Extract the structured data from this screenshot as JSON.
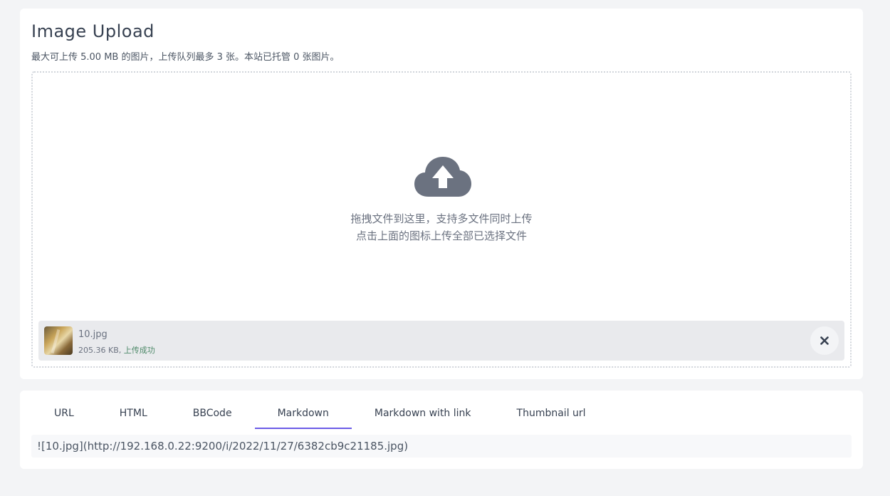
{
  "upload": {
    "title": "Image Upload",
    "subtitle": "最大可上传 5.00 MB 的图片，上传队列最多 3 张。本站已托管 0 张图片。",
    "drop_line1": "拖拽文件到这里，支持多文件同时上传",
    "drop_line2": "点击上面的图标上传全部已选择文件",
    "upload_icon": "cloud-upload-icon",
    "file": {
      "name": "10.jpg",
      "size": "205.36 KB, ",
      "status": "上传成功",
      "remove_icon": "close-icon"
    }
  },
  "result": {
    "tabs": [
      {
        "label": "URL"
      },
      {
        "label": "HTML"
      },
      {
        "label": "BBCode"
      },
      {
        "label": "Markdown"
      },
      {
        "label": "Markdown with link"
      },
      {
        "label": "Thumbnail url"
      }
    ],
    "active_tab": "Markdown",
    "output": "![10.jpg](http://192.168.0.22:9200/i/2022/11/27/6382cb9c21185.jpg)"
  },
  "colors": {
    "accent": "#6b5ce7",
    "success": "#4f8a6a",
    "icon": "#6b7280"
  }
}
